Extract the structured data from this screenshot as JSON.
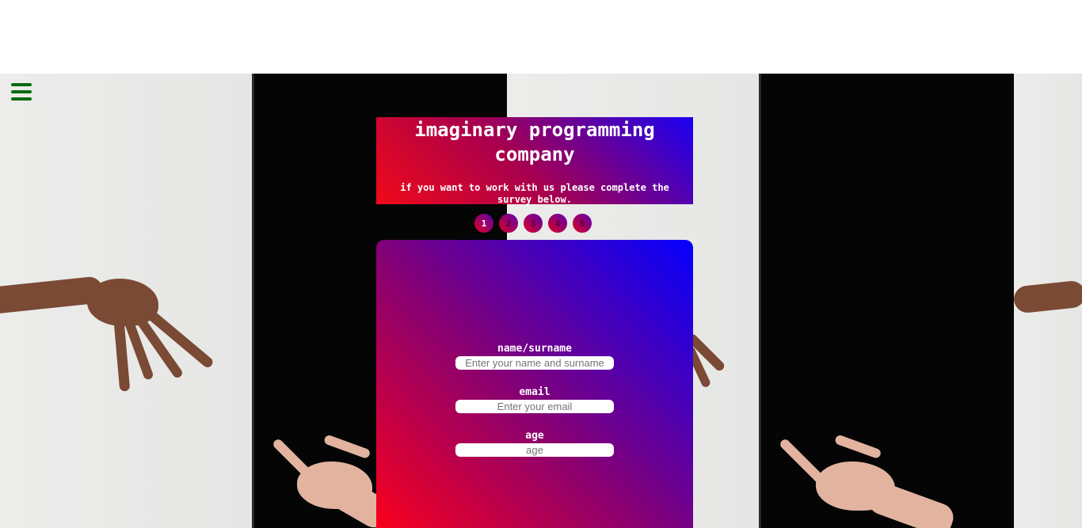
{
  "menu": {
    "icon": "hamburger-menu-icon",
    "color": "#0a6b10"
  },
  "header": {
    "title": "imaginary programming company",
    "subtitle": "if you want to work with us please complete the survey below."
  },
  "steps": [
    "1",
    "2",
    "3",
    "4",
    "5"
  ],
  "active_step": "1",
  "form": {
    "fields": [
      {
        "label": "name/surname",
        "placeholder": "Enter your name and surname"
      },
      {
        "label": "email",
        "placeholder": "Enter your email"
      },
      {
        "label": "age",
        "placeholder": "age"
      }
    ]
  },
  "colors": {
    "gradient_red": "#ff0018",
    "gradient_blue": "#0500ff"
  }
}
